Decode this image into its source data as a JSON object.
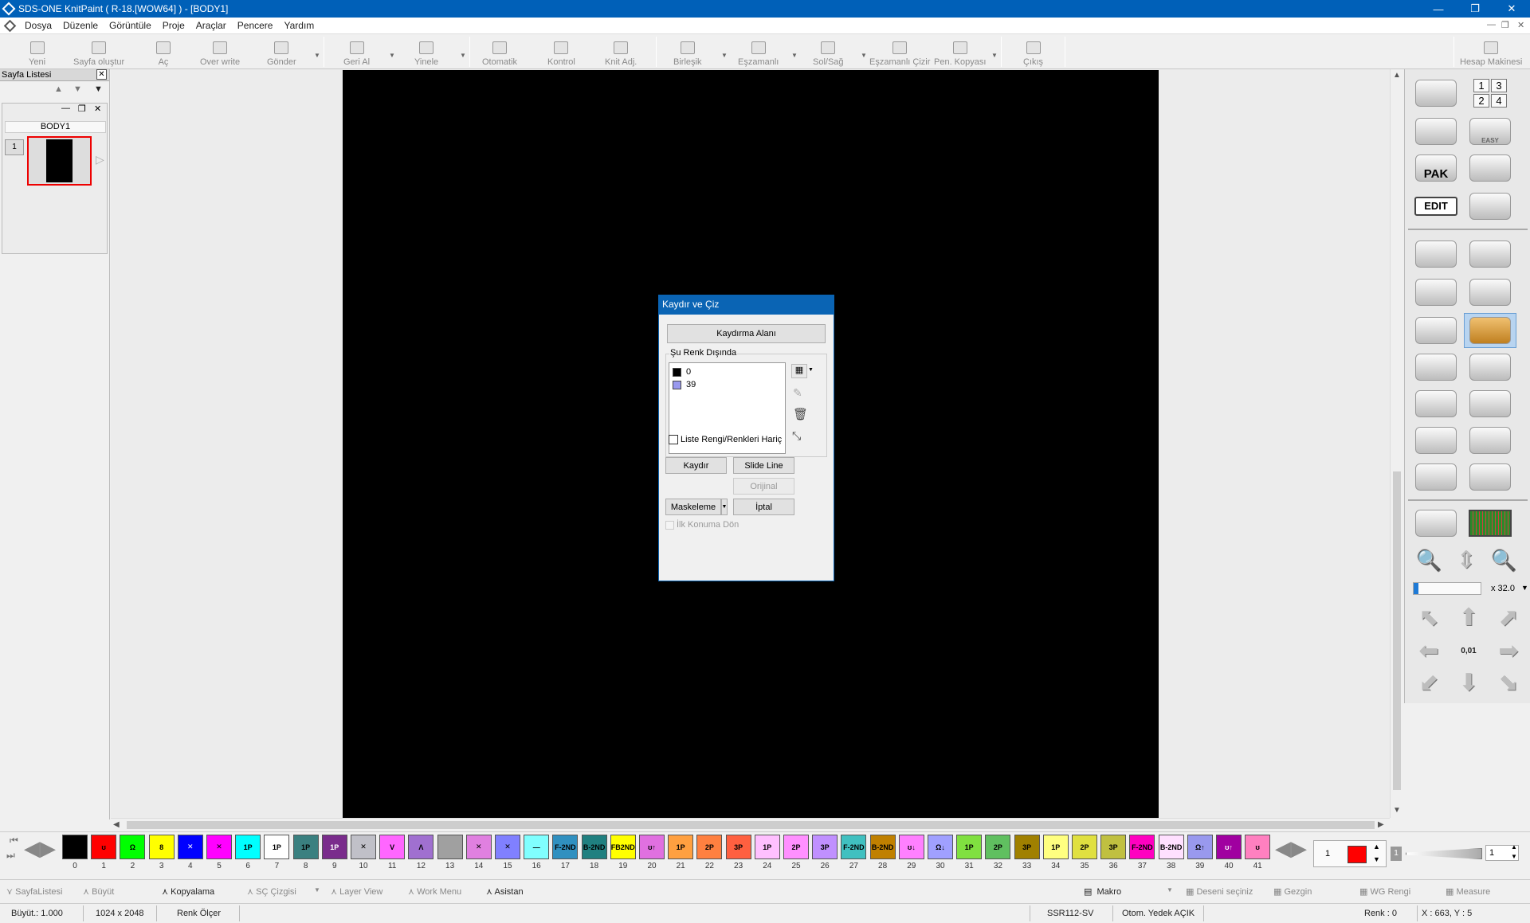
{
  "window": {
    "title": "SDS-ONE KnitPaint ( R-18.[WOW64] ) - [BODY1]"
  },
  "menu": [
    "Dosya",
    "Düzenle",
    "Görüntüle",
    "Proje",
    "Araçlar",
    "Pencere",
    "Yardım"
  ],
  "toolbar": [
    {
      "label": "Yeni",
      "icon": "new-file-icon"
    },
    {
      "label": "Sayfa oluştur",
      "icon": "page-create-icon"
    },
    {
      "label": "Aç",
      "icon": "open-icon"
    },
    {
      "label": "Over write",
      "icon": "overwrite-icon"
    },
    {
      "label": "Gönder",
      "icon": "send-icon"
    },
    {
      "label": "Geri Al",
      "icon": "undo-icon"
    },
    {
      "label": "Yinele",
      "icon": "redo-icon"
    },
    {
      "label": "Otomatik",
      "icon": "auto-icon"
    },
    {
      "label": "Kontrol",
      "icon": "control-icon"
    },
    {
      "label": "Knit Adj.",
      "icon": "knit-adjust-icon"
    },
    {
      "label": "Birleşik",
      "icon": "combine-icon"
    },
    {
      "label": "Eşzamanlı",
      "icon": "simultaneous-icon"
    },
    {
      "label": "Sol/Sağ",
      "icon": "left-right-icon"
    },
    {
      "label": "Eşzamanlı Çizir",
      "icon": "simultaneous-draw-icon"
    },
    {
      "label": "Pen. Kopyası",
      "icon": "window-copy-icon"
    },
    {
      "label": "Çıkış",
      "icon": "exit-icon"
    },
    {
      "label": "Hesap Makinesi",
      "icon": "calculator-icon"
    }
  ],
  "page_list": {
    "title": "Sayfa Listesi",
    "tab": "BODY1",
    "item_number": "1"
  },
  "dialog": {
    "title": "Kaydır ve Çiz",
    "area_button": "Kaydırma Alanı",
    "group_label": "Şu Renk Dışında",
    "colors": [
      {
        "label": "0",
        "swatch": "#000000"
      },
      {
        "label": "39",
        "swatch": "#9999ee"
      }
    ],
    "exclude_checkbox": "Liste Rengi/Renkleri Hariç",
    "slide_button": "Kaydır",
    "slide_line_button": "Slide Line",
    "original_button": "Orijinal",
    "mask_button": "Maskeleme",
    "cancel_button": "İptal",
    "return_checkbox": "İlk Konuma Dön"
  },
  "right_tools": {
    "edit_label": "EDIT",
    "pak_label": "PAK",
    "easy_label": "EASY",
    "zoom": "x 32.0",
    "nudge_label": "0,01",
    "number_grid": [
      "1",
      "3",
      "2",
      "4"
    ]
  },
  "palette": [
    {
      "n": "0",
      "c": "#000000",
      "t": ""
    },
    {
      "n": "1",
      "c": "#ff0000",
      "t": "ʊ"
    },
    {
      "n": "2",
      "c": "#00ff00",
      "t": "Ω"
    },
    {
      "n": "3",
      "c": "#ffff00",
      "t": "8"
    },
    {
      "n": "4",
      "c": "#0000ff",
      "t": "✕"
    },
    {
      "n": "5",
      "c": "#ff00ff",
      "t": "✕"
    },
    {
      "n": "6",
      "c": "#00ffff",
      "t": "1P"
    },
    {
      "n": "7",
      "c": "#ffffff",
      "t": "1P"
    },
    {
      "n": "8",
      "c": "#3a8080",
      "t": "1P"
    },
    {
      "n": "9",
      "c": "#7a2c8c",
      "t": "1P"
    },
    {
      "n": "10",
      "c": "#c0c0c8",
      "t": "✕"
    },
    {
      "n": "11",
      "c": "#ff66ff",
      "t": "V"
    },
    {
      "n": "12",
      "c": "#a070d0",
      "t": "Λ"
    },
    {
      "n": "13",
      "c": "#a0a0a0",
      "t": ""
    },
    {
      "n": "14",
      "c": "#e080e0",
      "t": "✕"
    },
    {
      "n": "15",
      "c": "#8080ff",
      "t": "✕"
    },
    {
      "n": "16",
      "c": "#80ffff",
      "t": "—"
    },
    {
      "n": "17",
      "c": "#3090c0",
      "t": "F-2ND"
    },
    {
      "n": "18",
      "c": "#208080",
      "t": "B-2ND"
    },
    {
      "n": "19",
      "c": "#ffff00",
      "t": "FB2ND"
    },
    {
      "n": "20",
      "c": "#e070e0",
      "t": "ʊ↑"
    },
    {
      "n": "21",
      "c": "#ffa040",
      "t": "1P"
    },
    {
      "n": "22",
      "c": "#ff8040",
      "t": "2P"
    },
    {
      "n": "23",
      "c": "#ff6040",
      "t": "3P"
    },
    {
      "n": "24",
      "c": "#ffc0ff",
      "t": "1P"
    },
    {
      "n": "25",
      "c": "#ff90ff",
      "t": "2P"
    },
    {
      "n": "26",
      "c": "#c090ff",
      "t": "3P"
    },
    {
      "n": "27",
      "c": "#40c0c0",
      "t": "F-2ND"
    },
    {
      "n": "28",
      "c": "#c08000",
      "t": "B-2ND"
    },
    {
      "n": "29",
      "c": "#ff80ff",
      "t": "ʊ↓"
    },
    {
      "n": "30",
      "c": "#a0a0ff",
      "t": "Ω↓"
    },
    {
      "n": "31",
      "c": "#80e040",
      "t": "1P"
    },
    {
      "n": "32",
      "c": "#60c060",
      "t": "2P"
    },
    {
      "n": "33",
      "c": "#a08000",
      "t": "3P"
    },
    {
      "n": "34",
      "c": "#ffff80",
      "t": "1P"
    },
    {
      "n": "35",
      "c": "#e0e040",
      "t": "2P"
    },
    {
      "n": "36",
      "c": "#c0c040",
      "t": "3P"
    },
    {
      "n": "37",
      "c": "#ff00c0",
      "t": "F-2ND"
    },
    {
      "n": "38",
      "c": "#ffe0ff",
      "t": "B-2ND"
    },
    {
      "n": "39",
      "c": "#9999ee",
      "t": "Ω↑"
    },
    {
      "n": "40",
      "c": "#a000a0",
      "t": "ʊ↑"
    },
    {
      "n": "41",
      "c": "#ff80c0",
      "t": "ʊ"
    }
  ],
  "palette_right": {
    "page": "1",
    "color": "#ff0000",
    "value": "1",
    "left_value": "1"
  },
  "bottom_tabs": [
    "SayfaListesi",
    "Büyüt",
    "Kopyalama",
    "SÇ Çizgisi",
    "Layer View",
    "Work Menu",
    "Asistan",
    "Makro",
    "Deseni seçiniz",
    "Gezgin",
    "WG Rengi",
    "Measure"
  ],
  "status": {
    "zoom": "Büyüt.: 1.000",
    "size": "1024 x 2048",
    "tool": "Renk Ölçer",
    "machine": "SSR112-SV",
    "backup": "Otom. Yedek AÇIK",
    "color": "Renk : 0",
    "coords": "X : 663, Y : 5"
  }
}
